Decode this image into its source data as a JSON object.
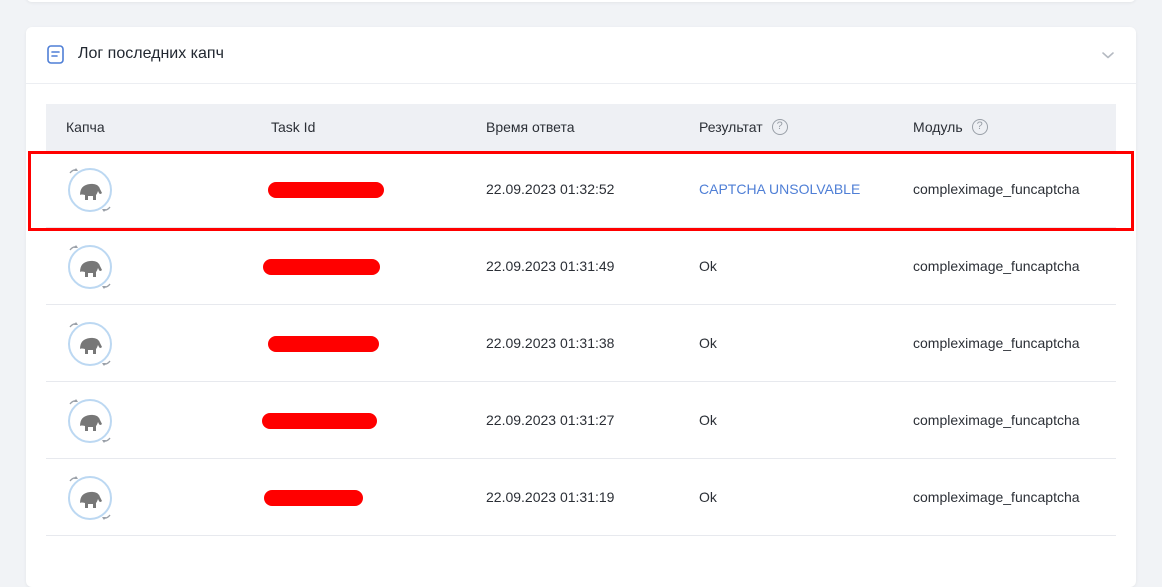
{
  "panel": {
    "title": "Лог последних капч",
    "icon": "document-icon",
    "toggle_icon": "chevron-down-icon"
  },
  "table": {
    "headers": {
      "captcha": "Капча",
      "task_id": "Task Id",
      "response_time": "Время ответа",
      "result": "Результат",
      "module": "Модуль"
    },
    "help_glyph": "?",
    "rows": [
      {
        "time": "22.09.2023 01:32:52",
        "result": "CAPTCHA UNSOLVABLE",
        "module": "compleximage_funcaptcha",
        "task_id_redacted": true,
        "highlighted": true
      },
      {
        "time": "22.09.2023 01:31:49",
        "result": "Ok",
        "module": "compleximage_funcaptcha",
        "task_id_redacted": true
      },
      {
        "time": "22.09.2023 01:31:38",
        "result": "Ok",
        "module": "compleximage_funcaptcha",
        "task_id_redacted": true
      },
      {
        "time": "22.09.2023 01:31:27",
        "result": "Ok",
        "module": "compleximage_funcaptcha",
        "task_id_redacted": true
      },
      {
        "time": "22.09.2023 01:31:19",
        "result": "Ok",
        "module": "compleximage_funcaptcha",
        "task_id_redacted": true
      }
    ]
  },
  "colors": {
    "accent_link": "#4f7fd6",
    "redaction": "#ff0000",
    "highlight_border": "#ff0000"
  }
}
